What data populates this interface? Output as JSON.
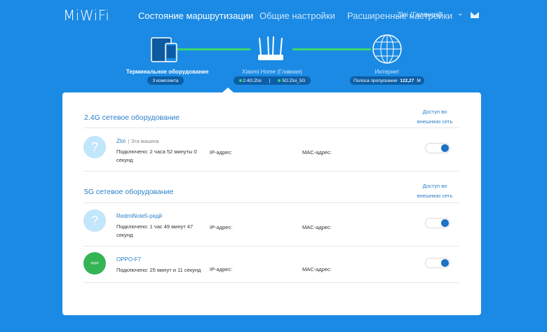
{
  "app": {
    "logo": "MiWiFi"
  },
  "nav": {
    "routing_status": "Состояние маршрутизации",
    "general_settings": "Общие настройки",
    "advanced_settings": "Расширенные настройки",
    "user": "Zloi (Главная)"
  },
  "topology": {
    "devices": {
      "label": "Терминальное оборудование",
      "count": "3 комплекта"
    },
    "router": {
      "label": "Xiaomi Home (Главная)",
      "band_24": "2.4G:Zloi",
      "band_5": "5G:Zloi_5G"
    },
    "internet": {
      "label": "Интернет",
      "bandwidth_label": "Полоса пропускания",
      "bandwidth_value": "122,27",
      "bandwidth_unit": "M"
    }
  },
  "sections": [
    {
      "title": "2.4G сетевое оборудование",
      "access_label": "Доступ во внешнюю сеть",
      "devices": [
        {
          "name": "Zloi",
          "tag": "| Эта машина",
          "connected": "Подключено: 2 часа 52 минуты 0 секунд",
          "ip_label": "IP-адрес:",
          "mac_label": "MAC-адрес:",
          "avatar": "question-mark",
          "internet_access": true
        }
      ]
    },
    {
      "title": "5G сетевое оборудование",
      "access_label": "Доступ во внешнюю сеть",
      "devices": [
        {
          "name": "RedmiNote5-редй",
          "connected": "Подключено: 1 час 49 минут 47 секунд",
          "ip_label": "IP-адрес:",
          "mac_label": "MAC-адрес:",
          "avatar": "question-mark",
          "internet_access": true
        },
        {
          "name": "OPPO-F7",
          "connected": "Подключено: 25 минут и 11 секунд",
          "ip_label": "IP-адрес:",
          "mac_label": "MAC-адрес:",
          "avatar": "oppo-logo",
          "internet_access": true
        }
      ]
    }
  ],
  "colors": {
    "background": "#1a8ae4",
    "accent": "#2a7fc8",
    "link_green": "#39d86c",
    "toggle_on": "#1d72c4"
  }
}
